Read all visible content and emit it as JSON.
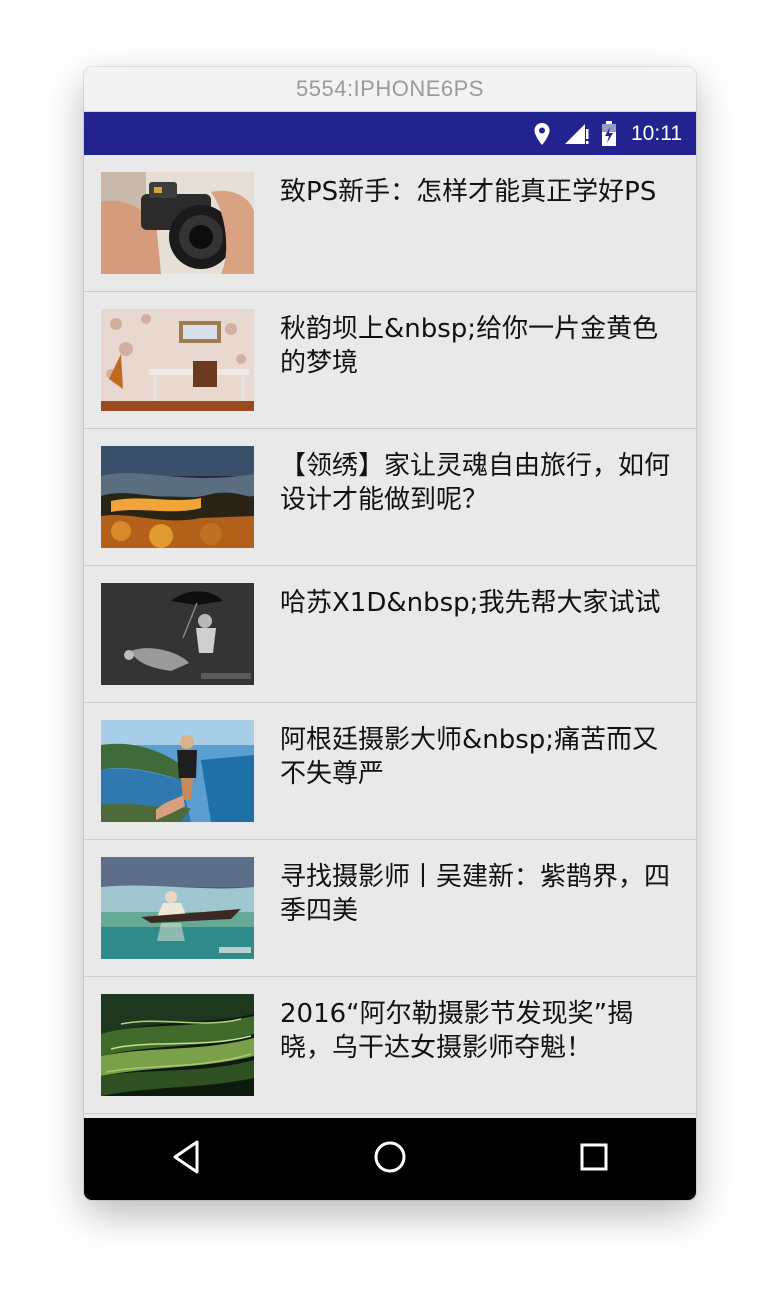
{
  "window": {
    "title": "5554:IPHONE6PS"
  },
  "status": {
    "time": "10:11",
    "bar_color": "#23238f"
  },
  "feed": {
    "items": [
      {
        "title": "致PS新手：怎样才能真正学好PS",
        "thumb": "camera-hands-image"
      },
      {
        "title": "秋韵坝上&nbsp;给你一片金黄色的梦境",
        "thumb": "vintage-room-image"
      },
      {
        "title": "【领绣】家让灵魂自由旅行，如何设计才能做到呢？",
        "thumb": "autumn-landscape-image"
      },
      {
        "title": "哈苏X1D&nbsp;我先帮大家试试",
        "thumb": "umbrella-figure-image"
      },
      {
        "title": "阿根廷摄影大师&nbsp;痛苦而又不失尊严",
        "thumb": "coast-followme-image"
      },
      {
        "title": "寻找摄影师丨吴建新：紫鹊界，四季四美",
        "thumb": "boat-reflection-image"
      },
      {
        "title": "2016“阿尔勒摄影节发现奖”揭晓，乌干达女摄影师夺魁！",
        "thumb": "terrace-fields-image"
      }
    ]
  },
  "nav": {
    "back": "back-icon",
    "home": "home-icon",
    "recents": "recents-icon"
  }
}
